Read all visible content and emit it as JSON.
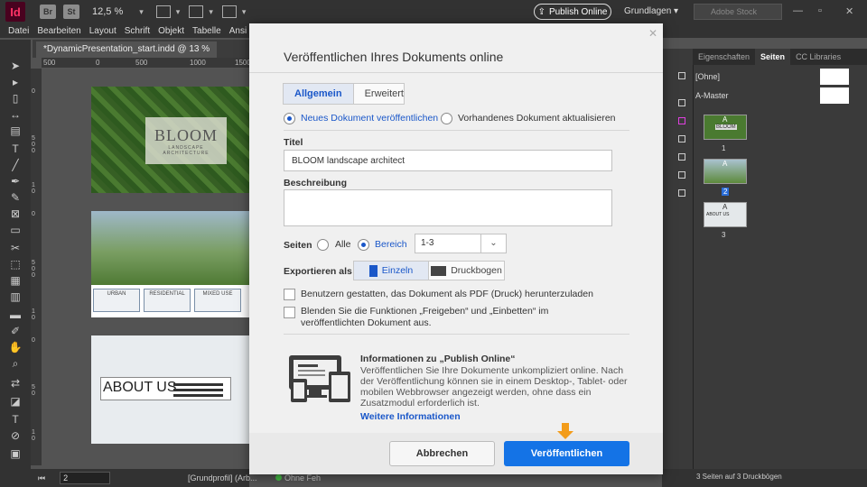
{
  "app": {
    "logo": "Id",
    "br": "Br",
    "st": "St",
    "zoom": "12,5 %",
    "publish_online": "Publish Online",
    "workspace": "Grundlagen",
    "stock_placeholder": "Adobe Stock"
  },
  "menu": [
    "Datei",
    "Bearbeiten",
    "Layout",
    "Schrift",
    "Objekt",
    "Tabelle",
    "Ansi"
  ],
  "document": {
    "tab_title": "*DynamicPresentation_start.indd @ 13 %",
    "ruler_h": [
      "500",
      "0",
      "500",
      "1000",
      "1500"
    ],
    "ruler_v": [
      "0",
      "5 0 0",
      "1 0",
      "0",
      "5 0 0",
      "1 0",
      "0",
      "5 0",
      "1 0"
    ],
    "page1": {
      "title": "BLOOM",
      "subtitle": "LANDSCAPE ARCHITECTURE"
    },
    "page2": {
      "tiles": [
        "URBAN",
        "RESIDENTIAL",
        "MIXED USE"
      ]
    },
    "page3": {
      "title": "ABOUT US"
    }
  },
  "status": {
    "page_number": "2",
    "profile": "[Grundprofil] (Arb...",
    "errors": "Ohne Feh"
  },
  "panels": {
    "tabs": [
      "Eigenschaften",
      "Seiten",
      "CC Libraries"
    ],
    "masters": [
      "[Ohne]",
      "A-Master"
    ],
    "pages": [
      "1",
      "2",
      "3"
    ],
    "thumb_labels": {
      "a": "A",
      "bloom": "BLOOM",
      "about": "ABOUT US"
    },
    "footer": "3 Seiten auf 3 Druckbögen"
  },
  "dialog": {
    "title": "Veröffentlichen Ihres Dokuments online",
    "tabs": [
      "Allgemein",
      "Erweitert"
    ],
    "radio_new": "Neues Dokument veröffentlichen",
    "radio_update": "Vorhandenes Dokument aktualisieren",
    "title_label": "Titel",
    "title_value": "BLOOM landscape architect",
    "desc_label": "Beschreibung",
    "desc_value": "",
    "pages_label": "Seiten",
    "pages_all": "Alle",
    "pages_range": "Bereich",
    "range_value": "1-3",
    "export_label": "Exportieren als",
    "export_single": "Einzeln",
    "export_spread": "Druckbogen",
    "check_pdf": "Benutzern gestatten, das Dokument als PDF (Druck) herunterzuladen",
    "check_hide": "Blenden Sie die Funktionen „Freigeben“ und „Einbetten“ im veröffentlichten Dokument aus.",
    "info_title": "Informationen zu „Publish Online“",
    "info_text": "Veröffentlichen Sie Ihre Dokumente unkompliziert online. Nach der Veröffentlichung können sie in einem Desktop-, Tablet- oder mobilen Webbrowser angezeigt werden, ohne dass ein Zusatzmodul erforderlich ist.",
    "info_link": "Weitere Informationen",
    "cancel": "Abbrechen",
    "publish": "Veröffentlichen"
  },
  "colors": {
    "accent": "#1473e6",
    "arrow": "#f39c1a",
    "indesign": "#ff3366"
  }
}
